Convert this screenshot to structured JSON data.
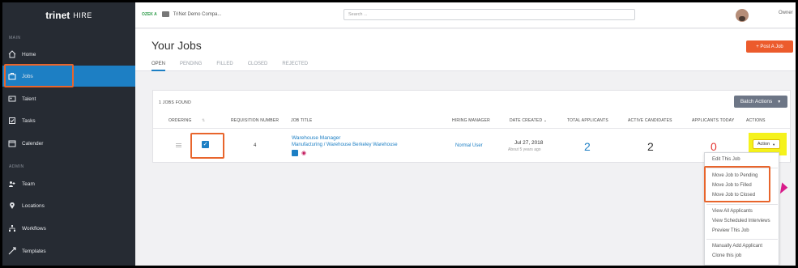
{
  "brand": {
    "name": "trinet",
    "product": "HIRE"
  },
  "sidebar": {
    "main_label": "MAIN",
    "admin_label": "ADMIN",
    "items": [
      {
        "label": "Home",
        "icon": "home-icon"
      },
      {
        "label": "Jobs",
        "icon": "briefcase-icon",
        "active": true
      },
      {
        "label": "Talent",
        "icon": "id-card-icon"
      },
      {
        "label": "Tasks",
        "icon": "tasks-icon"
      },
      {
        "label": "Calender",
        "icon": "calendar-icon"
      },
      {
        "label": "Team",
        "icon": "team-icon"
      },
      {
        "label": "Locations",
        "icon": "location-pin-icon"
      },
      {
        "label": "Workflows",
        "icon": "workflow-icon"
      },
      {
        "label": "Templates",
        "icon": "template-icon"
      }
    ]
  },
  "topbar": {
    "company_badge": "OZEK A",
    "company_name": "TriNet Demo Compa...",
    "search_placeholder": "Search ...",
    "user_label": "Owner"
  },
  "header": {
    "title": "Your Jobs",
    "tabs": [
      "OPEN",
      "PENDING",
      "FILLED",
      "CLOSED",
      "REJECTED"
    ],
    "post_button": "+ Post A Job"
  },
  "jobs_panel": {
    "found_text": "1 JOBS FOUND",
    "batch_button": "Batch Actions",
    "columns": [
      "ORDERING",
      "REQUISITION NUMBER",
      "JOB TITLE",
      "HIRING MANAGER",
      "DATE CREATED",
      "TOTAL APPLICANTS",
      "ACTIVE CANDIDATES",
      "APPLICANTS TODAY",
      "ACTIONS"
    ],
    "row": {
      "requisition_number": "4",
      "job_title": "Warehouse Manager",
      "job_subtitle": "Manufacturing / Warehouse Berkeley Warehouse",
      "hiring_manager": "Normal User",
      "date_created": "Jul 27, 2018",
      "date_relative": "About 5 years ago",
      "total_applicants": "2",
      "active_candidates": "2",
      "applicants_today": "0",
      "action_button": "Action"
    }
  },
  "action_menu": {
    "groups": [
      [
        "Edit This Job"
      ],
      [
        "Move Job to Pending",
        "Move Job to Filled",
        "Move Job to Closed"
      ],
      [
        "View All Applicants",
        "View Scheduled Interviews",
        "Preview This Job"
      ],
      [
        "Manually Add Applicant",
        "Clone this job"
      ]
    ]
  },
  "colors": {
    "sidebar_bg": "#262b33",
    "accent_blue": "#1d7fc4",
    "post_button": "#ec5b2c",
    "highlight_outline": "#e8652c",
    "highlight_yellow": "#f5f21c",
    "zero_red": "#e53935"
  }
}
